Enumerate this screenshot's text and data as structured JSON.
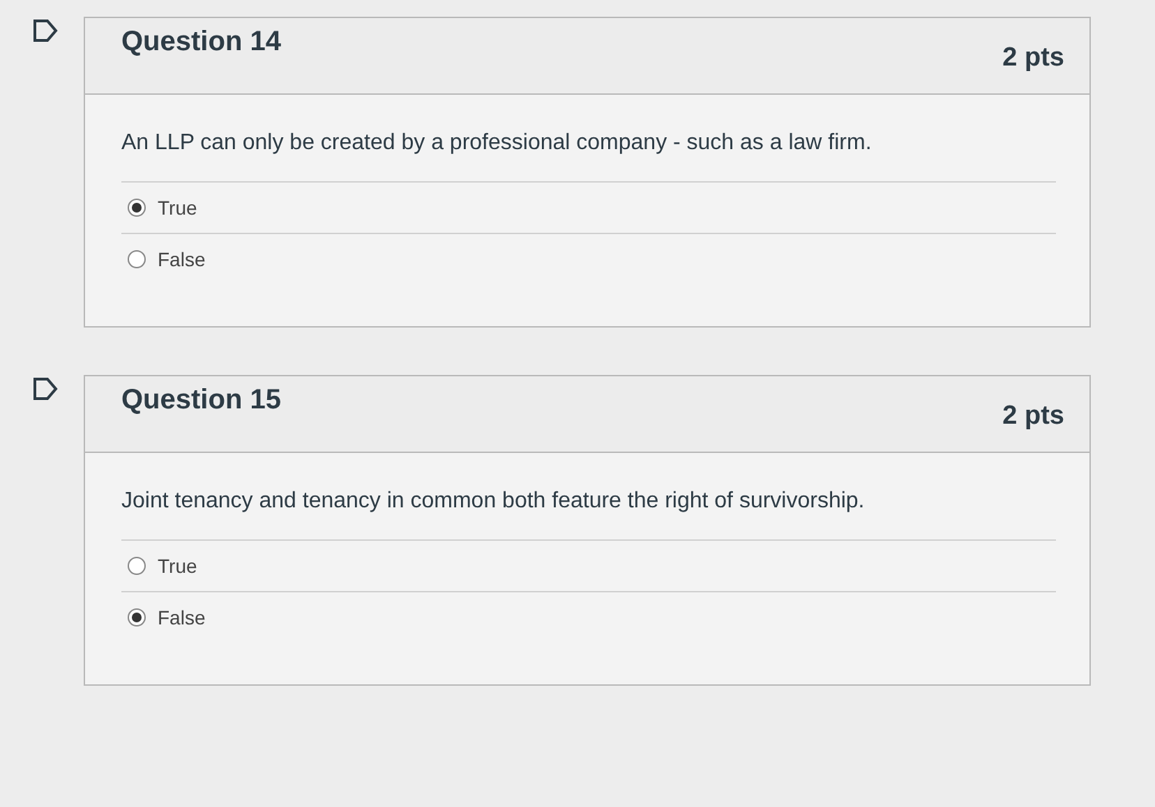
{
  "questions": [
    {
      "title": "Question 14",
      "points": "2 pts",
      "text": "An LLP can only be created by a professional company - such as a law firm.",
      "answers": [
        {
          "label": "True",
          "selected": true
        },
        {
          "label": "False",
          "selected": false
        }
      ]
    },
    {
      "title": "Question 15",
      "points": "2 pts",
      "text": "Joint tenancy and tenancy in common both feature the right of survivorship.",
      "answers": [
        {
          "label": "True",
          "selected": false
        },
        {
          "label": "False",
          "selected": true
        }
      ]
    }
  ]
}
